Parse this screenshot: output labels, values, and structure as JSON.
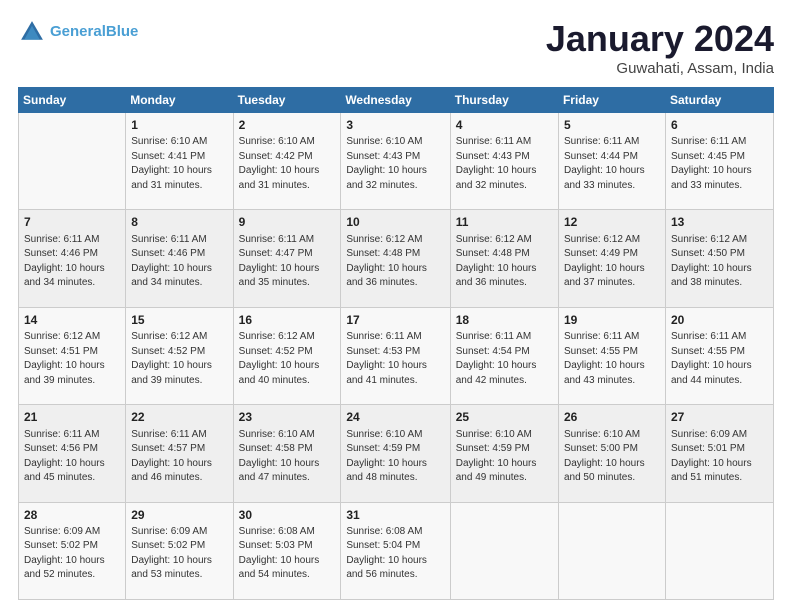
{
  "header": {
    "logo_line1": "General",
    "logo_line2": "Blue",
    "month": "January 2024",
    "location": "Guwahati, Assam, India"
  },
  "weekdays": [
    "Sunday",
    "Monday",
    "Tuesday",
    "Wednesday",
    "Thursday",
    "Friday",
    "Saturday"
  ],
  "weeks": [
    [
      {
        "day": "",
        "info": ""
      },
      {
        "day": "1",
        "info": "Sunrise: 6:10 AM\nSunset: 4:41 PM\nDaylight: 10 hours\nand 31 minutes."
      },
      {
        "day": "2",
        "info": "Sunrise: 6:10 AM\nSunset: 4:42 PM\nDaylight: 10 hours\nand 31 minutes."
      },
      {
        "day": "3",
        "info": "Sunrise: 6:10 AM\nSunset: 4:43 PM\nDaylight: 10 hours\nand 32 minutes."
      },
      {
        "day": "4",
        "info": "Sunrise: 6:11 AM\nSunset: 4:43 PM\nDaylight: 10 hours\nand 32 minutes."
      },
      {
        "day": "5",
        "info": "Sunrise: 6:11 AM\nSunset: 4:44 PM\nDaylight: 10 hours\nand 33 minutes."
      },
      {
        "day": "6",
        "info": "Sunrise: 6:11 AM\nSunset: 4:45 PM\nDaylight: 10 hours\nand 33 minutes."
      }
    ],
    [
      {
        "day": "7",
        "info": "Sunrise: 6:11 AM\nSunset: 4:46 PM\nDaylight: 10 hours\nand 34 minutes."
      },
      {
        "day": "8",
        "info": "Sunrise: 6:11 AM\nSunset: 4:46 PM\nDaylight: 10 hours\nand 34 minutes."
      },
      {
        "day": "9",
        "info": "Sunrise: 6:11 AM\nSunset: 4:47 PM\nDaylight: 10 hours\nand 35 minutes."
      },
      {
        "day": "10",
        "info": "Sunrise: 6:12 AM\nSunset: 4:48 PM\nDaylight: 10 hours\nand 36 minutes."
      },
      {
        "day": "11",
        "info": "Sunrise: 6:12 AM\nSunset: 4:48 PM\nDaylight: 10 hours\nand 36 minutes."
      },
      {
        "day": "12",
        "info": "Sunrise: 6:12 AM\nSunset: 4:49 PM\nDaylight: 10 hours\nand 37 minutes."
      },
      {
        "day": "13",
        "info": "Sunrise: 6:12 AM\nSunset: 4:50 PM\nDaylight: 10 hours\nand 38 minutes."
      }
    ],
    [
      {
        "day": "14",
        "info": "Sunrise: 6:12 AM\nSunset: 4:51 PM\nDaylight: 10 hours\nand 39 minutes."
      },
      {
        "day": "15",
        "info": "Sunrise: 6:12 AM\nSunset: 4:52 PM\nDaylight: 10 hours\nand 39 minutes."
      },
      {
        "day": "16",
        "info": "Sunrise: 6:12 AM\nSunset: 4:52 PM\nDaylight: 10 hours\nand 40 minutes."
      },
      {
        "day": "17",
        "info": "Sunrise: 6:11 AM\nSunset: 4:53 PM\nDaylight: 10 hours\nand 41 minutes."
      },
      {
        "day": "18",
        "info": "Sunrise: 6:11 AM\nSunset: 4:54 PM\nDaylight: 10 hours\nand 42 minutes."
      },
      {
        "day": "19",
        "info": "Sunrise: 6:11 AM\nSunset: 4:55 PM\nDaylight: 10 hours\nand 43 minutes."
      },
      {
        "day": "20",
        "info": "Sunrise: 6:11 AM\nSunset: 4:55 PM\nDaylight: 10 hours\nand 44 minutes."
      }
    ],
    [
      {
        "day": "21",
        "info": "Sunrise: 6:11 AM\nSunset: 4:56 PM\nDaylight: 10 hours\nand 45 minutes."
      },
      {
        "day": "22",
        "info": "Sunrise: 6:11 AM\nSunset: 4:57 PM\nDaylight: 10 hours\nand 46 minutes."
      },
      {
        "day": "23",
        "info": "Sunrise: 6:10 AM\nSunset: 4:58 PM\nDaylight: 10 hours\nand 47 minutes."
      },
      {
        "day": "24",
        "info": "Sunrise: 6:10 AM\nSunset: 4:59 PM\nDaylight: 10 hours\nand 48 minutes."
      },
      {
        "day": "25",
        "info": "Sunrise: 6:10 AM\nSunset: 4:59 PM\nDaylight: 10 hours\nand 49 minutes."
      },
      {
        "day": "26",
        "info": "Sunrise: 6:10 AM\nSunset: 5:00 PM\nDaylight: 10 hours\nand 50 minutes."
      },
      {
        "day": "27",
        "info": "Sunrise: 6:09 AM\nSunset: 5:01 PM\nDaylight: 10 hours\nand 51 minutes."
      }
    ],
    [
      {
        "day": "28",
        "info": "Sunrise: 6:09 AM\nSunset: 5:02 PM\nDaylight: 10 hours\nand 52 minutes."
      },
      {
        "day": "29",
        "info": "Sunrise: 6:09 AM\nSunset: 5:02 PM\nDaylight: 10 hours\nand 53 minutes."
      },
      {
        "day": "30",
        "info": "Sunrise: 6:08 AM\nSunset: 5:03 PM\nDaylight: 10 hours\nand 54 minutes."
      },
      {
        "day": "31",
        "info": "Sunrise: 6:08 AM\nSunset: 5:04 PM\nDaylight: 10 hours\nand 56 minutes."
      },
      {
        "day": "",
        "info": ""
      },
      {
        "day": "",
        "info": ""
      },
      {
        "day": "",
        "info": ""
      }
    ]
  ]
}
